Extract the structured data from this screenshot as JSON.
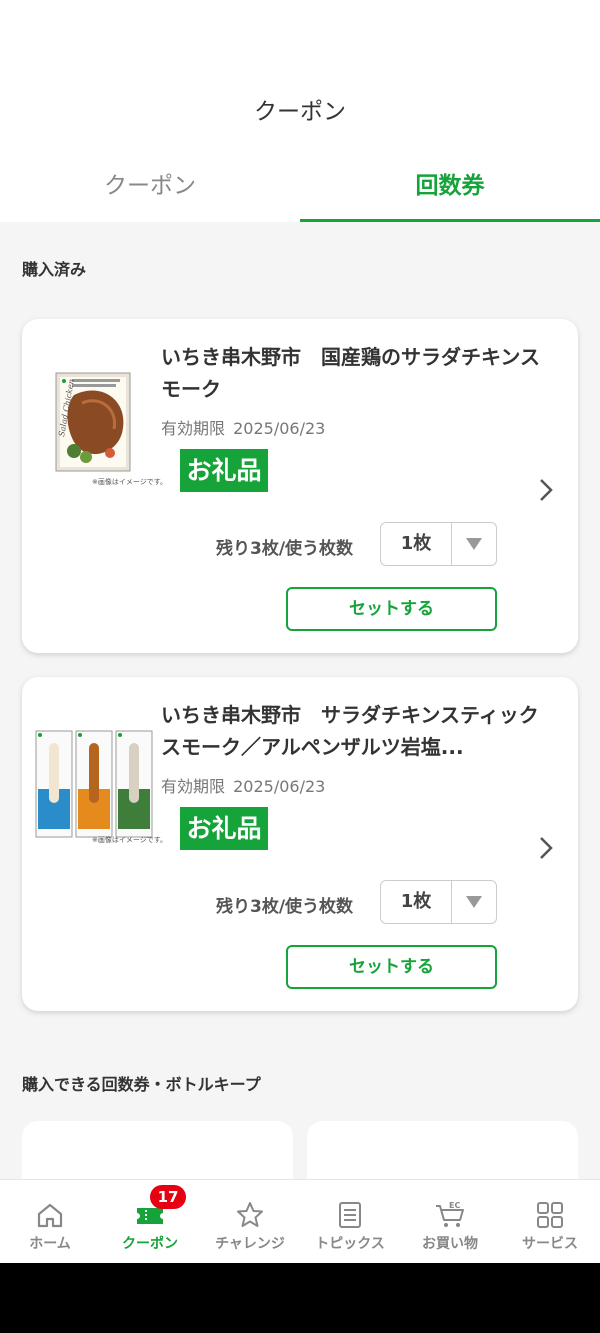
{
  "header": {
    "title": "クーポン",
    "tabs": [
      {
        "label": "クーポン",
        "active": false
      },
      {
        "label": "回数券",
        "active": true
      }
    ]
  },
  "sections": {
    "purchased_title": "購入済み",
    "buyable_title": "購入できる回数券・ボトルキープ"
  },
  "products": [
    {
      "name": "いちき串木野市　国産鶏のサラダチキンスモーク",
      "expiry_label": "有効期限",
      "expiry_date": "2025/06/23",
      "badge": "お礼品",
      "remain_label": "残り3枚/使う枚数",
      "qty": "1枚",
      "set_button": "セットする",
      "image_note": "※画像はイメージです。"
    },
    {
      "name": "いちき串木野市　サラダチキンスティック　スモーク／アルペンザルツ岩塩...",
      "expiry_label": "有効期限",
      "expiry_date": "2025/06/23",
      "badge": "お礼品",
      "remain_label": "残り3枚/使う枚数",
      "qty": "1枚",
      "set_button": "セットする",
      "image_note": "※画像はイメージです。"
    }
  ],
  "bottom_nav": {
    "items": [
      {
        "label": "ホーム",
        "icon": "home-icon"
      },
      {
        "label": "クーポン",
        "icon": "coupon-icon",
        "active": true,
        "badge": "17"
      },
      {
        "label": "チャレンジ",
        "icon": "star-icon"
      },
      {
        "label": "トピックス",
        "icon": "document-icon"
      },
      {
        "label": "お買い物",
        "icon": "cart-icon",
        "icon_text": "EC"
      },
      {
        "label": "サービス",
        "icon": "grid-icon"
      }
    ]
  },
  "colors": {
    "accent": "#16a33a",
    "badge_red": "#e60012",
    "background": "#f5f5f5"
  }
}
